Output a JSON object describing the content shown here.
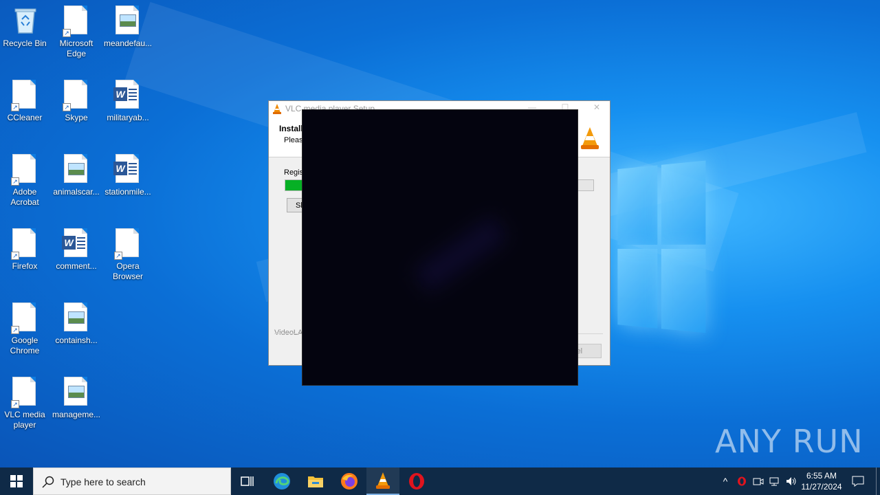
{
  "desktop": {
    "icons": [
      {
        "label": "Recycle Bin",
        "type": "recycle-bin"
      },
      {
        "label": "Microsoft Edge",
        "type": "shortcut"
      },
      {
        "label": "meandefau...",
        "type": "image"
      },
      {
        "label": "CCleaner",
        "type": "shortcut"
      },
      {
        "label": "Skype",
        "type": "shortcut"
      },
      {
        "label": "militaryab...",
        "type": "word"
      },
      {
        "label": "Adobe Acrobat",
        "type": "shortcut"
      },
      {
        "label": "animalscar...",
        "type": "image"
      },
      {
        "label": "stationmile...",
        "type": "word"
      },
      {
        "label": "Firefox",
        "type": "shortcut"
      },
      {
        "label": "comment...",
        "type": "word"
      },
      {
        "label": "Opera Browser",
        "type": "shortcut"
      },
      {
        "label": "Google Chrome",
        "type": "shortcut"
      },
      {
        "label": "containsh...",
        "type": "image"
      },
      {
        "label": "VLC media player",
        "type": "shortcut"
      },
      {
        "label": "manageme...",
        "type": "image"
      }
    ]
  },
  "setup_window": {
    "title": "VLC media player Setup",
    "heading": "Install",
    "subheading": "Pleas",
    "status_text": "Regis",
    "progress_fraction": 0.06,
    "show_details_label": "Sh",
    "brand_text": "VideoLAN",
    "cancel_label": "cel"
  },
  "taskbar": {
    "search_placeholder": "Type here to search",
    "pinned": [
      "task-view",
      "edge",
      "file-explorer",
      "firefox",
      "vlc",
      "opera"
    ],
    "clock_time": "6:55 AM",
    "clock_date": "11/27/2024"
  },
  "watermark": {
    "text": "ANY RUN"
  }
}
